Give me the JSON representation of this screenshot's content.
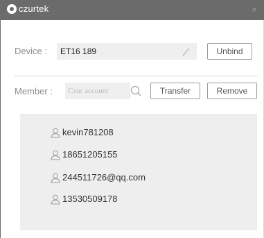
{
  "window": {
    "brand": "czurtek",
    "close_glyph": "×"
  },
  "device": {
    "label": "Device :",
    "value": "ET16 189",
    "unbind_label": "Unbind"
  },
  "member": {
    "label": "Member :",
    "placeholder": "Czur account",
    "transfer_label": "Transfer",
    "remove_label": "Remove"
  },
  "members": [
    "kevin781208",
    "18651205155",
    "244511726@qq.com",
    "13530509178"
  ],
  "colors": {
    "titlebar": "#6b6b6b",
    "panel": "#eeeeee",
    "field": "#efefef"
  },
  "icons": [
    "pencil-icon",
    "search-icon",
    "user-icon",
    "close-icon",
    "czur-logo-icon"
  ]
}
